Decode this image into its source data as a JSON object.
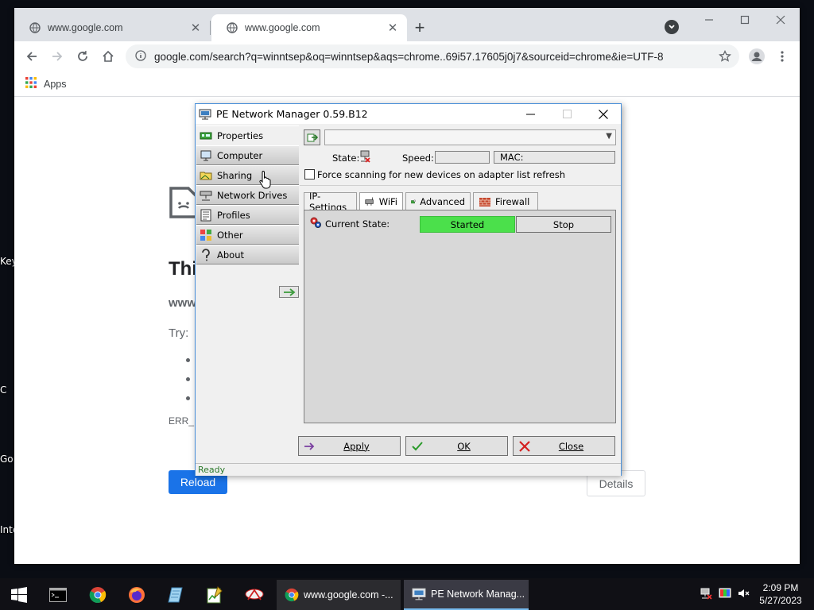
{
  "desktop": {
    "labels": [
      "Key",
      "C",
      "Go",
      "Inte"
    ]
  },
  "chrome": {
    "tabs": [
      {
        "title": "www.google.com"
      },
      {
        "title": "www.google.com"
      }
    ],
    "url": "google.com/search?q=winntsep&oq=winntsep&aqs=chrome..69i57.17605j0j7&sourceid=chrome&ie=UTF-8",
    "bookmarks": {
      "apps_label": "Apps"
    }
  },
  "error_page": {
    "title": "Thi",
    "host": "www",
    "try_label": "Try:",
    "error_code": "ERR_N",
    "reload_label": "Reload",
    "details_label": "Details"
  },
  "pe": {
    "title": "PE Network Manager 0.59.B12",
    "nav": [
      {
        "label": "Properties",
        "icon": "network-card-icon"
      },
      {
        "label": "Computer",
        "icon": "computer-icon"
      },
      {
        "label": "Sharing",
        "icon": "folder-share-icon"
      },
      {
        "label": "Network Drives",
        "icon": "network-drive-icon"
      },
      {
        "label": "Profiles",
        "icon": "profiles-icon"
      },
      {
        "label": "Other",
        "icon": "other-icon"
      },
      {
        "label": "About",
        "icon": "about-icon"
      }
    ],
    "adapter_value": "",
    "state_label": "State:",
    "speed_label": "Speed:",
    "speed_value": "",
    "mac_label": "MAC:",
    "mac_value": "",
    "force_scan_label": "Force scanning for new devices on adapter list refresh",
    "force_scan_checked": false,
    "tabs": [
      {
        "label": "IP-Settings",
        "icon": ""
      },
      {
        "label": "WiFi",
        "icon": "wifi-card-icon"
      },
      {
        "label": "Advanced",
        "icon": "advanced-icon"
      },
      {
        "label": "Firewall",
        "icon": "firewall-icon"
      }
    ],
    "selected_tab": "WiFi",
    "current_state_label": "Current State:",
    "current_state_value": "Started",
    "stop_label": "Stop",
    "apply_label": "Apply",
    "ok_label": "OK",
    "close_label": "Close",
    "status": "Ready",
    "colors": {
      "started": "#4be04b",
      "status_text": "#2c7a2c"
    }
  },
  "taskbar": {
    "apps": [
      {
        "label": "www.google.com -..."
      },
      {
        "label": "PE Network Manag..."
      }
    ],
    "time": "2:09 PM",
    "date": "5/27/2023"
  }
}
